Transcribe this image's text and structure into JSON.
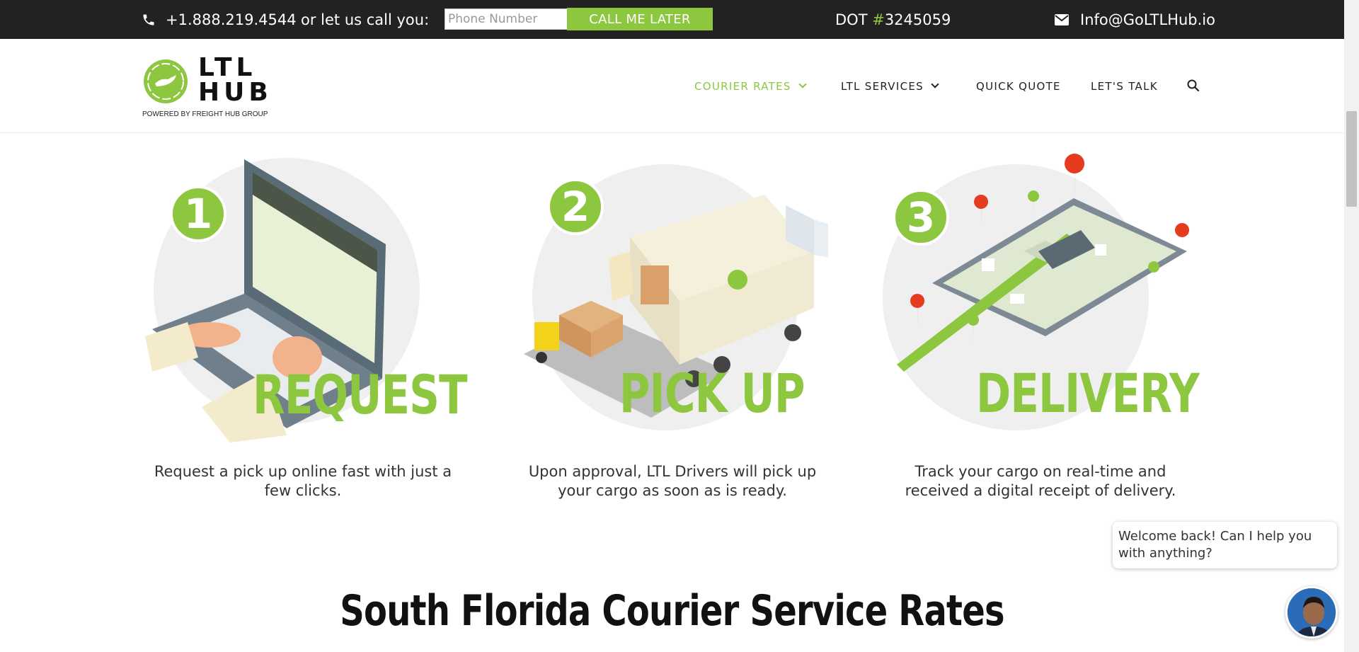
{
  "topbar": {
    "phone": "+1.888.219.4544",
    "call_prompt": "or let us call you:",
    "phone_placeholder": "Phone Number",
    "call_button": "CALL ME LATER",
    "dot_label": "DOT ",
    "dot_hash": "#",
    "dot_number": "3245059",
    "email": "Info@GoLTLHub.io"
  },
  "header": {
    "logo_line1": "LTL",
    "logo_line2": "HUB",
    "logo_sub": "POWERED BY FREIGHT HUB GROUP",
    "nav": [
      {
        "label": "COURIER RATES",
        "active": true,
        "dropdown": true
      },
      {
        "label": "LTL SERVICES",
        "active": false,
        "dropdown": true
      },
      {
        "label": "QUICK QUOTE",
        "active": false,
        "dropdown": false
      },
      {
        "label": "LET'S TALK",
        "active": false,
        "dropdown": false
      }
    ]
  },
  "steps": [
    {
      "number": "1",
      "title": "REQUEST",
      "description": "Request a pick up online fast with just a few clicks."
    },
    {
      "number": "2",
      "title": "PICK UP",
      "description": "Upon approval, LTL Drivers will pick up your cargo as soon as is ready."
    },
    {
      "number": "3",
      "title": "DELIVERY",
      "description": "Track your cargo on real-time and received a digital receipt of delivery."
    }
  ],
  "section_title": "South Florida Courier Service Rates",
  "chat": {
    "message": "Welcome back! Can I help you with anything?"
  },
  "colors": {
    "brand_green": "#8dc63f",
    "topbar_bg": "#222222"
  }
}
